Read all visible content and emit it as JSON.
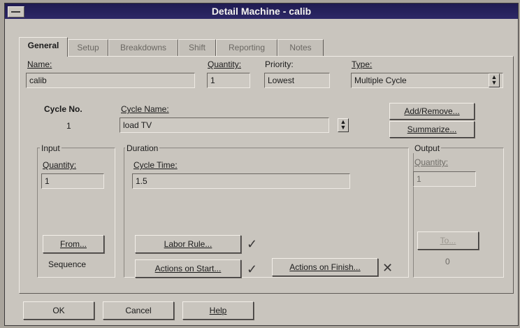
{
  "window": {
    "title": "Detail Machine - calib"
  },
  "tabs": [
    {
      "label": "General",
      "active": true
    },
    {
      "label": "Setup"
    },
    {
      "label": "Breakdowns"
    },
    {
      "label": "Shift"
    },
    {
      "label": "Reporting"
    },
    {
      "label": "Notes"
    }
  ],
  "general": {
    "name_label": "Name:",
    "name_value": "calib",
    "quantity_label": "Quantity:",
    "quantity_value": "1",
    "priority_label": "Priority:",
    "priority_value": "Lowest",
    "type_label": "Type:",
    "type_value": "Multiple Cycle"
  },
  "cycle": {
    "number_label": "Cycle No.",
    "number_value": "1",
    "name_label": "Cycle Name:",
    "name_value": "load TV",
    "add_remove_label": "Add/Remove...",
    "summarize_label": "Summarize..."
  },
  "input": {
    "section_label": "Input",
    "quantity_label": "Quantity:",
    "quantity_value": "1",
    "from_label": "From...",
    "sequence_text": "Sequence"
  },
  "duration": {
    "section_label": "Duration",
    "cycle_time_label": "Cycle Time:",
    "cycle_time_value": "1.5",
    "labor_rule_label": "Labor Rule...",
    "labor_rule_mark": "✓",
    "actions_start_label": "Actions on Start...",
    "actions_start_mark": "✓",
    "actions_finish_label": "Actions on Finish...",
    "actions_finish_mark": "✕"
  },
  "output": {
    "section_label": "Output",
    "quantity_label": "Quantity:",
    "quantity_value": "1",
    "to_label": "To...",
    "count_text": "0"
  },
  "footer": {
    "ok_label": "OK",
    "cancel_label": "Cancel",
    "help_label": "Help"
  }
}
